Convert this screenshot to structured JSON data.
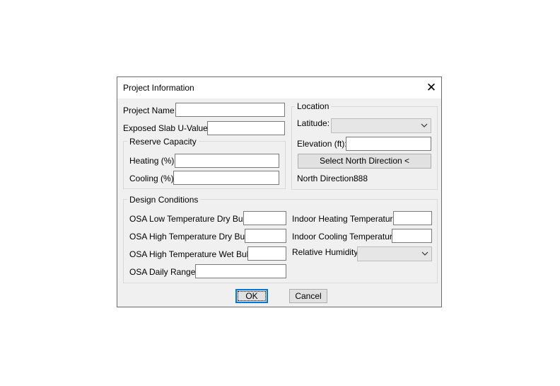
{
  "dialog": {
    "title": "Project Information",
    "close_glyph": "✕"
  },
  "project": {
    "name_label": "Project Name:",
    "name_value": "",
    "slab_label": "Exposed Slab U-Value:",
    "slab_value": ""
  },
  "reserve_capacity": {
    "title": "Reserve Capacity",
    "heating_label": "Heating (%):",
    "heating_value": "",
    "cooling_label": "Cooling (%):",
    "cooling_value": ""
  },
  "location": {
    "title": "Location",
    "latitude_label": "Latitude:",
    "latitude_value": "",
    "elevation_label": "Elevation (ft):",
    "elevation_value": "",
    "select_north_button": "Select North Direction <",
    "north_direction_label": "North Direction:",
    "north_direction_value": "888"
  },
  "design_conditions": {
    "title": "Design Conditions",
    "osa_low_dry_label": "OSA Low Temperature Dry Bulb:",
    "osa_low_dry_value": "",
    "osa_high_dry_label": "OSA High Temperature Dry Bulb:",
    "osa_high_dry_value": "",
    "osa_high_wet_label": "OSA High Temperature Wet Bulb:",
    "osa_high_wet_value": "",
    "osa_daily_range_label": "OSA Daily Range:",
    "osa_daily_range_value": "",
    "indoor_heating_label": "Indoor Heating Temperature:",
    "indoor_heating_value": "",
    "indoor_cooling_label": "Indoor Cooling Temperature:",
    "indoor_cooling_value": "",
    "humidity_label": "Relative Humidity:",
    "humidity_value": ""
  },
  "buttons": {
    "ok": "OK",
    "cancel": "Cancel"
  },
  "icons": {
    "close": "close-icon",
    "dropdown": "chevron-down-icon"
  }
}
